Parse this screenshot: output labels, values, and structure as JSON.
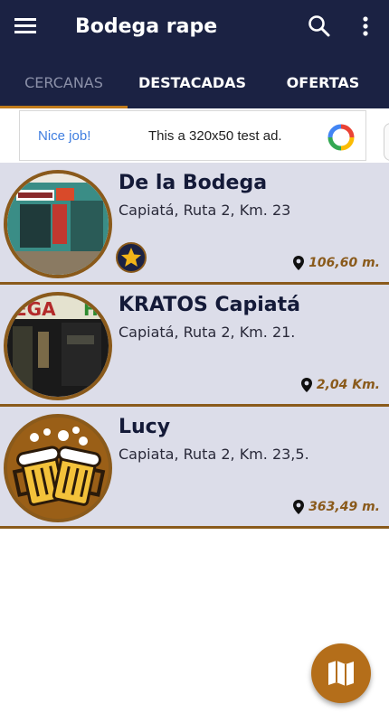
{
  "appbar": {
    "title": "Bodega rape",
    "icons": {
      "menu": "menu-icon",
      "search": "search-icon",
      "more": "more-vert-icon"
    }
  },
  "tabs": [
    {
      "label": "CERCANAS",
      "selected": true
    },
    {
      "label": "DESTACADAS",
      "selected": false
    },
    {
      "label": "OFERTAS",
      "selected": false
    }
  ],
  "ad": {
    "left_text": "Nice job!",
    "center_text": "This a 320x50 test ad."
  },
  "places": [
    {
      "name": "De la Bodega",
      "address": "Capiatá, Ruta 2, Km. 23",
      "distance": "106,60 m.",
      "featured": true
    },
    {
      "name": "KRATOS Capiatá",
      "address": "Capiatá, Ruta 2, Km. 21.",
      "distance": "2,04 Km.",
      "featured": false
    },
    {
      "name": "Lucy",
      "address": "Capiata, Ruta 2, Km. 23,5.",
      "distance": "363,49 m.",
      "featured": false
    }
  ],
  "colors": {
    "appbar": "#1b2243",
    "accent": "#c07a1b",
    "card_bg": "#dcdde9",
    "card_border": "#8a5a1b"
  },
  "fab": {
    "icon": "map-icon"
  }
}
